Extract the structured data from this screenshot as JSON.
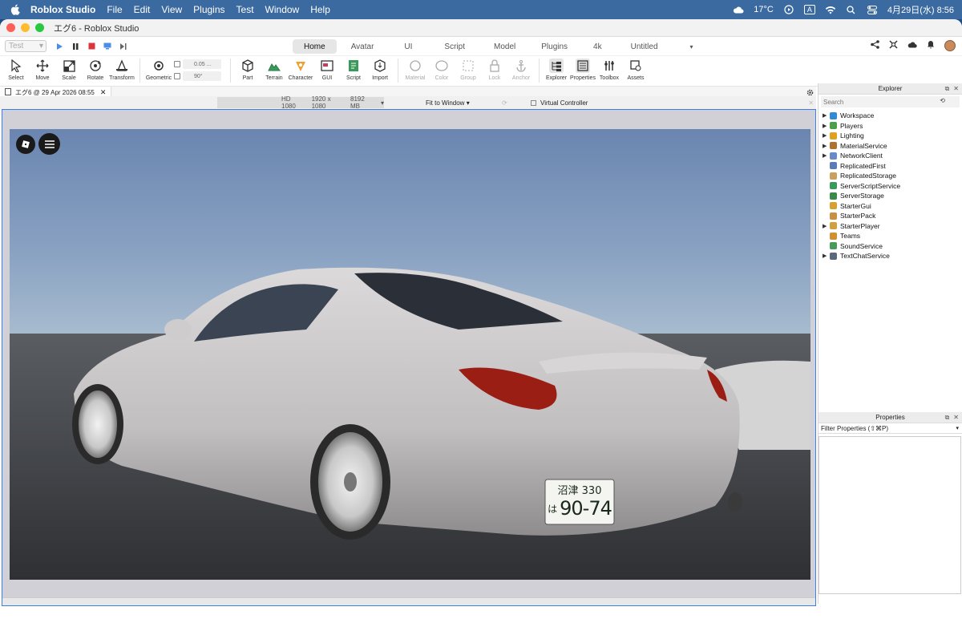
{
  "menubar": {
    "app_name": "Roblox Studio",
    "items": [
      "File",
      "Edit",
      "View",
      "Plugins",
      "Test",
      "Window",
      "Help"
    ],
    "weather": "17°C",
    "input_mode": "A",
    "datetime": "4月29日(水) 8:56"
  },
  "window": {
    "title": "エグ6 - Roblox Studio"
  },
  "toolbar": {
    "test_select": "Test",
    "tabs": [
      "Home",
      "Avatar",
      "UI",
      "Script",
      "Model",
      "Plugins",
      "4k",
      "Untitled"
    ],
    "active_tab": "Home"
  },
  "ribbon": {
    "tools": [
      {
        "label": "Select",
        "icon": "cursor-icon"
      },
      {
        "label": "Move",
        "icon": "move-icon"
      },
      {
        "label": "Scale",
        "icon": "scale-icon"
      },
      {
        "label": "Rotate",
        "icon": "rotate-icon"
      },
      {
        "label": "Transform",
        "icon": "transform-icon"
      }
    ],
    "geometric_label": "Geometric",
    "snap_move": "0.05 ...",
    "snap_rotate": "90°",
    "insert_tools": [
      {
        "label": "Part",
        "icon": "part-icon"
      },
      {
        "label": "Terrain",
        "icon": "terrain-icon"
      },
      {
        "label": "Character",
        "icon": "character-icon"
      },
      {
        "label": "GUI",
        "icon": "gui-icon"
      },
      {
        "label": "Script",
        "icon": "script-icon"
      },
      {
        "label": "Import",
        "icon": "import-icon"
      }
    ],
    "edit_tools": [
      {
        "label": "Material"
      },
      {
        "label": "Color"
      },
      {
        "label": "Group"
      },
      {
        "label": "Lock"
      },
      {
        "label": "Anchor"
      }
    ],
    "panel_tools": [
      {
        "label": "Explorer"
      },
      {
        "label": "Properties"
      },
      {
        "label": "Toolbox"
      },
      {
        "label": "Assets"
      }
    ]
  },
  "document_tab": {
    "label": "エグ6 @ 29 Apr 2026 08:55"
  },
  "viewport_toolbar": {
    "device": "HD 1080",
    "resolution": "1920 x 1080",
    "memory": "8192 MB",
    "fit": "Fit to Window",
    "virtual_controller": "Virtual Controller"
  },
  "viewport": {
    "plate_top": "沼津 330",
    "plate_kana": "は",
    "plate_number": "90-74",
    "sky_color": "#6f8fb8",
    "car_color": "#c9c6c8"
  },
  "explorer": {
    "title": "Explorer",
    "search_placeholder": "Search",
    "items": [
      {
        "label": "Workspace",
        "expandable": true,
        "color": "#2f8bd6"
      },
      {
        "label": "Players",
        "expandable": true,
        "color": "#4aa04a"
      },
      {
        "label": "Lighting",
        "expandable": true,
        "color": "#e0a020"
      },
      {
        "label": "MaterialService",
        "expandable": true,
        "color": "#b07030"
      },
      {
        "label": "NetworkClient",
        "expandable": true,
        "color": "#6a8ac8"
      },
      {
        "label": "ReplicatedFirst",
        "expandable": false,
        "color": "#5a7ab8"
      },
      {
        "label": "ReplicatedStorage",
        "expandable": false,
        "color": "#c8a060"
      },
      {
        "label": "ServerScriptService",
        "expandable": false,
        "color": "#3a9a5a"
      },
      {
        "label": "ServerStorage",
        "expandable": false,
        "color": "#3a8a4a"
      },
      {
        "label": "StarterGui",
        "expandable": false,
        "color": "#d8a030"
      },
      {
        "label": "StarterPack",
        "expandable": false,
        "color": "#c89040"
      },
      {
        "label": "StarterPlayer",
        "expandable": true,
        "color": "#d0a040"
      },
      {
        "label": "Teams",
        "expandable": false,
        "color": "#d09030"
      },
      {
        "label": "SoundService",
        "expandable": false,
        "color": "#4a9a5a"
      },
      {
        "label": "TextChatService",
        "expandable": true,
        "color": "#5a6a7a"
      }
    ]
  },
  "properties": {
    "title": "Properties",
    "filter_placeholder": "Filter Properties (⇧⌘P)"
  }
}
